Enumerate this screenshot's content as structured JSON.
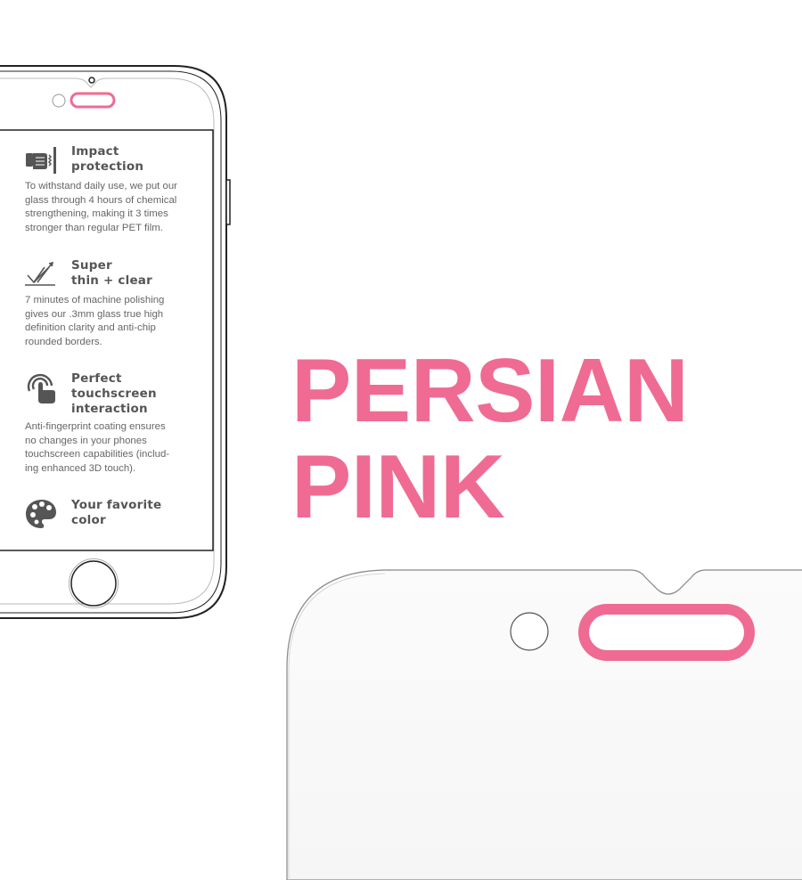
{
  "colors": {
    "accent": "#ef6b93",
    "outline": "#222222",
    "text_title": "#555555",
    "text_body": "#666666",
    "background": "#ffffff"
  },
  "features": [
    {
      "icon": "fist-impact-icon",
      "title_lines": [
        "Impact",
        "protection"
      ],
      "body_lines": [
        "To withstand daily use, we put our",
        "glass through 4 hours of chemical",
        "strengthening, making it 3 times",
        "stronger than regular PET film."
      ]
    },
    {
      "icon": "thin-clear-icon",
      "title_lines": [
        "Super",
        "thin + clear"
      ],
      "body_lines": [
        "7 minutes of machine polishing",
        "gives our .3mm glass true high",
        "definition clarity and anti-chip",
        "rounded borders."
      ]
    },
    {
      "icon": "touch-finger-icon",
      "title_lines": [
        "Perfect",
        "touchscreen",
        "interaction"
      ],
      "body_lines": [
        "Anti-fingerprint coating ensures",
        "no changes in your phones",
        "touchscreen capabilities (includ-",
        "ing enhanced 3D touch)."
      ]
    },
    {
      "icon": "palette-icon",
      "title_lines": [
        "Your favorite",
        "color"
      ],
      "body_lines": []
    }
  ],
  "headline": {
    "line1": "PERSIAN",
    "line2": "PINK"
  }
}
